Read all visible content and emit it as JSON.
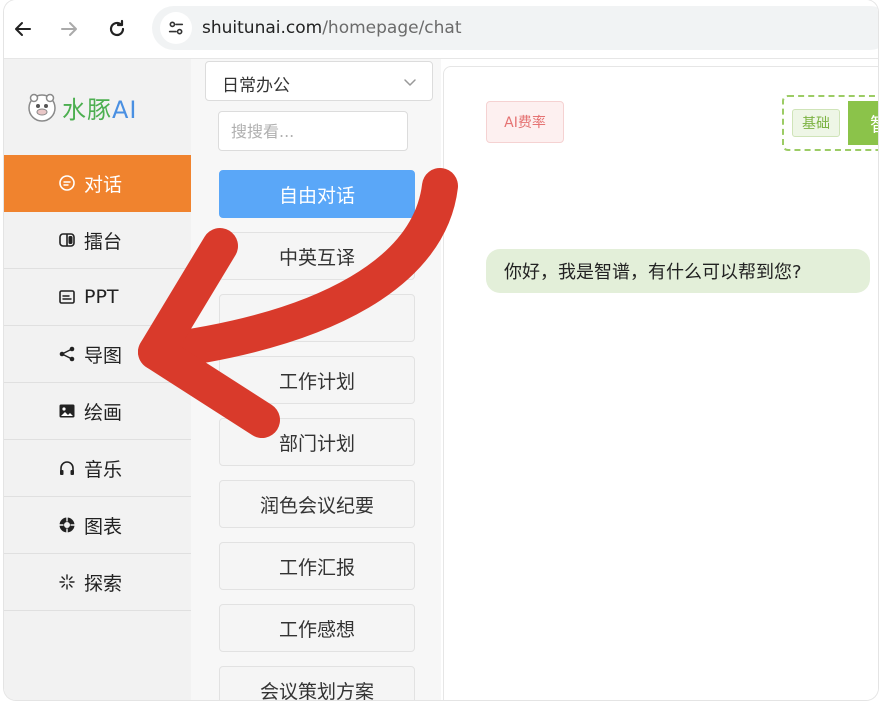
{
  "browser": {
    "url_host": "shuitunai.com",
    "url_path": "/homepage/chat"
  },
  "sidebar": {
    "logo_text_part1": "水豚",
    "logo_text_part2": "AI",
    "items": [
      {
        "label": "对话",
        "icon": "chat-bubble-icon",
        "active": true
      },
      {
        "label": "擂台",
        "icon": "game-controller-icon",
        "active": false
      },
      {
        "label": "PPT",
        "icon": "slides-icon",
        "active": false
      },
      {
        "label": "导图",
        "icon": "share-nodes-icon",
        "active": false
      },
      {
        "label": "绘画",
        "icon": "image-icon",
        "active": false
      },
      {
        "label": "音乐",
        "icon": "headphones-icon",
        "active": false
      },
      {
        "label": "图表",
        "icon": "chart-icon",
        "active": false
      },
      {
        "label": "探索",
        "icon": "sparkle-icon",
        "active": false
      }
    ]
  },
  "scenarios": {
    "category_selected": "日常办公",
    "search_placeholder": "搜搜看...",
    "items": [
      {
        "label": "自由对话",
        "active": true
      },
      {
        "label": "中英互译",
        "active": false
      },
      {
        "label": "",
        "active": false
      },
      {
        "label": "工作计划",
        "active": false
      },
      {
        "label": "部门计划",
        "active": false
      },
      {
        "label": "润色会议纪要",
        "active": false
      },
      {
        "label": "工作汇报",
        "active": false
      },
      {
        "label": "工作感想",
        "active": false
      },
      {
        "label": "会议策划方案",
        "active": false
      }
    ]
  },
  "chat": {
    "rate_tag": "AI费率",
    "mode_basic": "基础",
    "mode_smart": "智",
    "greeting": "你好，我是智谱，有什么可以帮到您?"
  },
  "colors": {
    "active_nav": "#f0832e",
    "primary_button": "#5aa7f8",
    "annotation_arrow": "#d93a2b"
  }
}
